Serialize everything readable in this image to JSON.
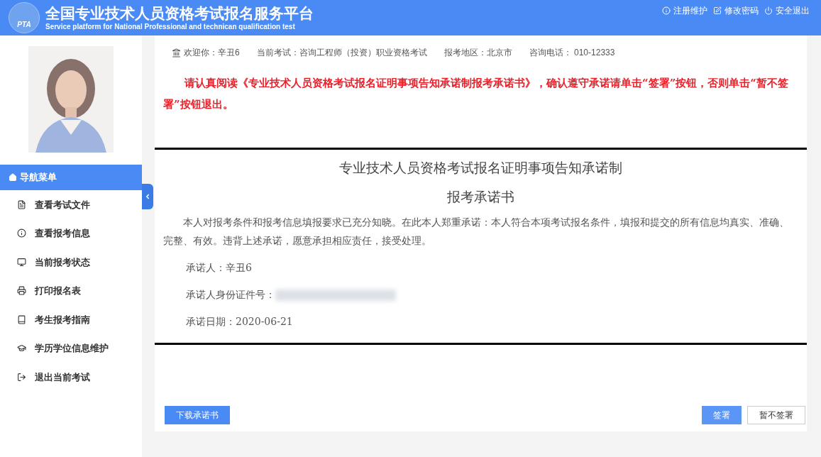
{
  "header": {
    "logo_text": "PTA",
    "title": "全国专业技术人员资格考试报名服务平台",
    "subtitle": "Service platform for National Professional and technican qualification test",
    "links": [
      "注册维护",
      "修改密码",
      "安全退出"
    ]
  },
  "sidebar": {
    "menu_title": "导航菜单",
    "items": [
      "查看考试文件",
      "查看报考信息",
      "当前报考状态",
      "打印报名表",
      "考生报考指南",
      "学历学位信息维护",
      "退出当前考试"
    ]
  },
  "info_bar": [
    "欢迎你：辛丑6",
    "当前考试：咨询工程师（投资）职业资格考试",
    "报考地区：北京市",
    "咨询电话： 010-12333"
  ],
  "notice": "请认真阅读《专业技术人员资格考试报名证明事项告知承诺制报考承诺书》，确认遵守承诺请单击“签署”按钮，否则单击“暂不签署”按钮退出。",
  "document": {
    "title": "专业技术人员资格考试报名证明事项告知承诺制",
    "subtitle": "报考承诺书",
    "paragraph": "本人对报考条件和报考信息填报要求已充分知晓。在此本人郑重承诺：本人符合本项考试报名条件，填报和提交的所有信息均真实、准确、完整、有效。违背上述承诺，愿意承担相应责任，接受处理。",
    "fields": [
      {
        "text": "承诺人：辛丑6",
        "blurred": false
      },
      {
        "text": "承诺人身份证件号：",
        "blurred": true
      },
      {
        "text": "承诺日期：2020-06-21",
        "blurred": false
      }
    ]
  },
  "buttons": {
    "download": "下载承诺书",
    "sign": "签署",
    "decline": "暂不签署"
  }
}
